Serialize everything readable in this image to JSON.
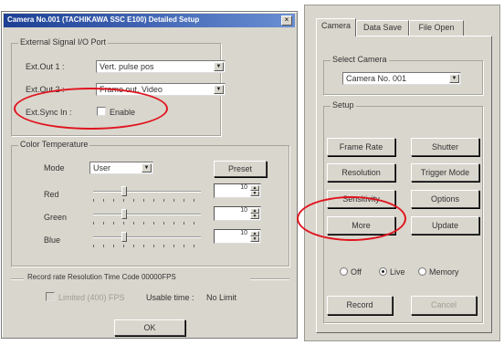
{
  "dialog": {
    "title": "Camera No.001 (TACHIKAWA SSC E100) Detailed Setup",
    "close_label": "×",
    "ext_port": {
      "group_label": "External Signal I/O Port",
      "out1_label": "Ext.Out 1 :",
      "out1_value": "Vert. pulse pos",
      "out2_label": "Ext.Out 2 :",
      "out2_value": "Frame out, Video",
      "sync_label": "Ext.Sync In :",
      "sync_check_label": "Enable"
    },
    "color_temp": {
      "group_label": "Color Temperature",
      "mode_label": "Mode",
      "mode_value": "User",
      "preset_label": "Preset",
      "channels": [
        {
          "label": "Red",
          "value": "10",
          "level": 0.28
        },
        {
          "label": "Green",
          "value": "10",
          "level": 0.28
        },
        {
          "label": "Blue",
          "value": "10",
          "level": 0.28
        }
      ]
    },
    "record": {
      "group_label": "Record rate Resolution Time Code 00000FPS",
      "check_label": "Limited (400) FPS",
      "usable_label": "Usable time :",
      "usable_value": "No Limit"
    },
    "ok_label": "OK"
  },
  "panel": {
    "tabs": [
      "Camera",
      "Data Save",
      "File Open"
    ],
    "select_group_label": "Select Camera",
    "camera_value": "Camera No. 001",
    "setup_group_label": "Setup",
    "buttons": {
      "frame_rate": "Frame Rate",
      "shutter": "Shutter",
      "resolution": "Resolution",
      "trigger_mode": "Trigger Mode",
      "sensitivity": "Sensitivity",
      "options": "Options",
      "more": "More",
      "update": "Update"
    },
    "radios": {
      "off": "Off",
      "live": "Live",
      "memory": "Memory",
      "selected": "live"
    },
    "record_label": "Record",
    "cancel_label": "Cancel"
  },
  "colors": {
    "face": "#d9d6cd",
    "title_start": "#1c3f95",
    "title_end": "#6a8fd3",
    "annotation_red": "#e0141e"
  },
  "icons": [
    "close-icon",
    "dropdown-arrow-icon",
    "spin-up-icon",
    "spin-down-icon"
  ]
}
